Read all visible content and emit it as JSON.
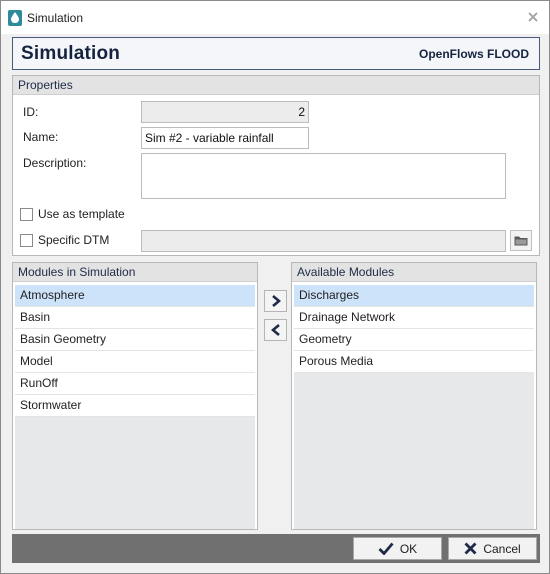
{
  "window": {
    "title": "Simulation",
    "icon": "water-drop-icon",
    "close_icon": "close-icon"
  },
  "header": {
    "title": "Simulation",
    "brand": "OpenFlows FLOOD",
    "border_color": "#4a5a7a"
  },
  "properties": {
    "section_label": "Properties",
    "id_label": "ID:",
    "id_value": "2",
    "name_label": "Name:",
    "name_value": "Sim #2 - variable rainfall",
    "description_label": "Description:",
    "description_value": "",
    "use_template_label": "Use as template",
    "use_template_checked": false,
    "specific_dtm_label": "Specific DTM",
    "specific_dtm_checked": false,
    "dtm_value": "",
    "browse_icon": "folder-icon"
  },
  "modules_in_simulation": {
    "label": "Modules in Simulation",
    "items": [
      "Atmosphere",
      "Basin",
      "Basin Geometry",
      "Model",
      "RunOff",
      "Stormwater"
    ],
    "selected": "Atmosphere"
  },
  "available_modules": {
    "label": "Available Modules",
    "items": [
      "Discharges",
      "Drainage Network",
      "Geometry",
      "Porous Media"
    ],
    "selected": "Discharges"
  },
  "move_buttons": {
    "add_icon": "chevron-right-icon",
    "remove_icon": "chevron-left-icon"
  },
  "footer": {
    "ok_label": "OK",
    "cancel_label": "Cancel",
    "ok_icon": "checkmark-icon",
    "cancel_icon": "x-icon"
  },
  "colors": {
    "selection": "#cde3fa",
    "accent": "#15233f",
    "footer_bg": "#707070"
  }
}
